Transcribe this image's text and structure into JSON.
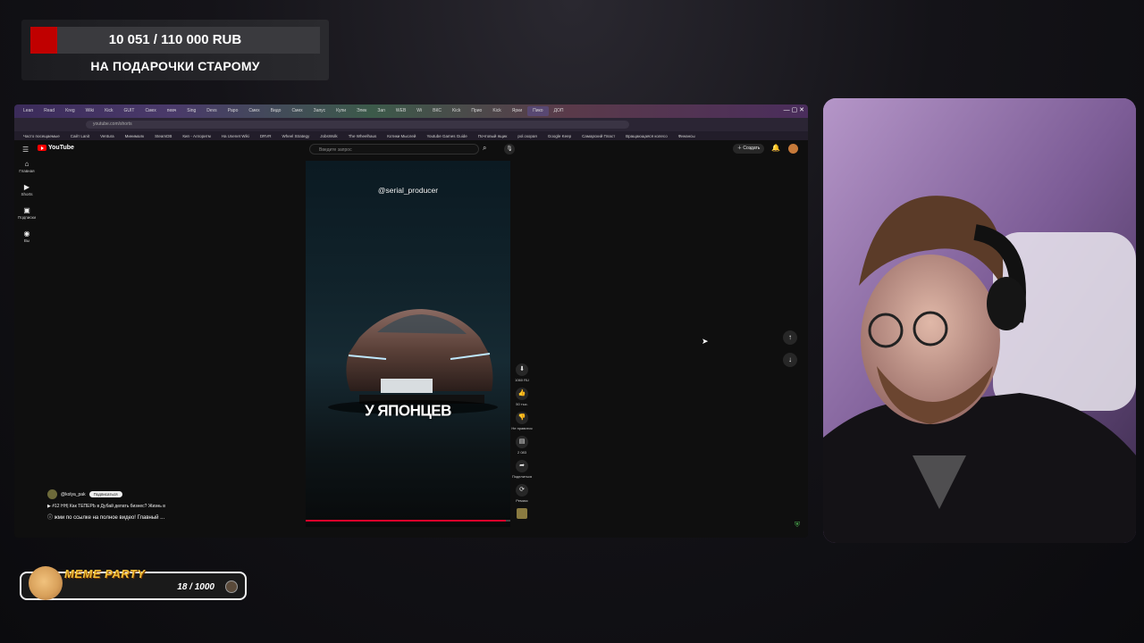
{
  "goal": {
    "amount": "10 051 / 110 000 RUB",
    "progress": 0.0914,
    "title": "НА ПОДАРОЧКИ СТАРОМУ",
    "accent_color": "#c00000"
  },
  "browser": {
    "tabs": [
      "Lean",
      "Read",
      "Kreg",
      "Wiki",
      "Kick",
      "GUIT",
      "Смех",
      "певч",
      "Sing",
      "Devs",
      "Papo",
      "Смех",
      "Видо",
      "Смех",
      "Запус",
      "Купи",
      "Элек",
      "Зап",
      "WEB",
      "Wi",
      "ВКС",
      "Kick",
      "Прио",
      "Kick",
      "Ярки",
      "Пико",
      "ДОП"
    ],
    "active_tab_index": 25,
    "address": "youtube.com/shorts",
    "bookmarks": [
      "Часто посещаемые",
      "Сайт Lanit",
      "Ventura",
      "Минималк",
      "SteamDB",
      "Кип - Алгоритм",
      "На Usenet Wiki",
      "DRVR",
      "Wheel Strategy",
      "JobsWolk",
      "The Wheelhaus",
      "Котики Мыслей",
      "Youtube Games Guide",
      "Почтовый ящик",
      "pol.скорая",
      "Google Keep",
      "Самарский Пласт",
      "Вращающаяся колесо",
      "Финансы"
    ]
  },
  "youtube": {
    "logo_text": "YouTube",
    "search_placeholder": "Введите запрос",
    "create_label": "Создать",
    "nav": [
      {
        "icon": "home-icon",
        "label": "Главная"
      },
      {
        "icon": "shorts-icon",
        "label": "Shorts"
      },
      {
        "icon": "subscriptions-icon",
        "label": "Подписки"
      },
      {
        "icon": "you-icon",
        "label": "Вы"
      }
    ],
    "short": {
      "author_overlay": "@serial_producer",
      "caption": "У ЯПОНЦЕВ",
      "progress": 0.98
    },
    "actions": {
      "download_label": "1060 RU",
      "likes": "50 тыс.",
      "dislike_label": "Не нравится",
      "comments": "2 083",
      "share_label": "Поделиться",
      "remix_label": "Ремикс"
    },
    "channel": {
      "name": "@kolya_pak",
      "subscribe_label": "Подписаться",
      "title": "#12 НН| Как ТЕПЕРЬ в Дубай делать бизнес? Жизнь в",
      "description": "жми по ссылке на полное видео! Главный ..."
    }
  },
  "meme_party": {
    "title": "MEME PARTY",
    "progress": "18 / 1000"
  }
}
